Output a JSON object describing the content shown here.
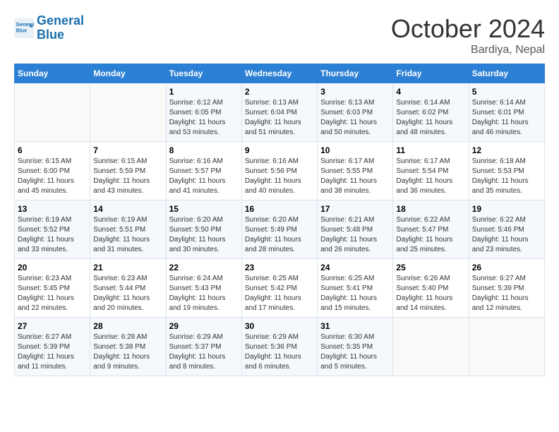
{
  "header": {
    "logo_line1": "General",
    "logo_line2": "Blue",
    "month": "October 2024",
    "location": "Bardiya, Nepal"
  },
  "weekdays": [
    "Sunday",
    "Monday",
    "Tuesday",
    "Wednesday",
    "Thursday",
    "Friday",
    "Saturday"
  ],
  "weeks": [
    [
      {
        "day": "",
        "text": ""
      },
      {
        "day": "",
        "text": ""
      },
      {
        "day": "1",
        "text": "Sunrise: 6:12 AM\nSunset: 6:05 PM\nDaylight: 11 hours and 53 minutes."
      },
      {
        "day": "2",
        "text": "Sunrise: 6:13 AM\nSunset: 6:04 PM\nDaylight: 11 hours and 51 minutes."
      },
      {
        "day": "3",
        "text": "Sunrise: 6:13 AM\nSunset: 6:03 PM\nDaylight: 11 hours and 50 minutes."
      },
      {
        "day": "4",
        "text": "Sunrise: 6:14 AM\nSunset: 6:02 PM\nDaylight: 11 hours and 48 minutes."
      },
      {
        "day": "5",
        "text": "Sunrise: 6:14 AM\nSunset: 6:01 PM\nDaylight: 11 hours and 46 minutes."
      }
    ],
    [
      {
        "day": "6",
        "text": "Sunrise: 6:15 AM\nSunset: 6:00 PM\nDaylight: 11 hours and 45 minutes."
      },
      {
        "day": "7",
        "text": "Sunrise: 6:15 AM\nSunset: 5:59 PM\nDaylight: 11 hours and 43 minutes."
      },
      {
        "day": "8",
        "text": "Sunrise: 6:16 AM\nSunset: 5:57 PM\nDaylight: 11 hours and 41 minutes."
      },
      {
        "day": "9",
        "text": "Sunrise: 6:16 AM\nSunset: 5:56 PM\nDaylight: 11 hours and 40 minutes."
      },
      {
        "day": "10",
        "text": "Sunrise: 6:17 AM\nSunset: 5:55 PM\nDaylight: 11 hours and 38 minutes."
      },
      {
        "day": "11",
        "text": "Sunrise: 6:17 AM\nSunset: 5:54 PM\nDaylight: 11 hours and 36 minutes."
      },
      {
        "day": "12",
        "text": "Sunrise: 6:18 AM\nSunset: 5:53 PM\nDaylight: 11 hours and 35 minutes."
      }
    ],
    [
      {
        "day": "13",
        "text": "Sunrise: 6:19 AM\nSunset: 5:52 PM\nDaylight: 11 hours and 33 minutes."
      },
      {
        "day": "14",
        "text": "Sunrise: 6:19 AM\nSunset: 5:51 PM\nDaylight: 11 hours and 31 minutes."
      },
      {
        "day": "15",
        "text": "Sunrise: 6:20 AM\nSunset: 5:50 PM\nDaylight: 11 hours and 30 minutes."
      },
      {
        "day": "16",
        "text": "Sunrise: 6:20 AM\nSunset: 5:49 PM\nDaylight: 11 hours and 28 minutes."
      },
      {
        "day": "17",
        "text": "Sunrise: 6:21 AM\nSunset: 5:48 PM\nDaylight: 11 hours and 26 minutes."
      },
      {
        "day": "18",
        "text": "Sunrise: 6:22 AM\nSunset: 5:47 PM\nDaylight: 11 hours and 25 minutes."
      },
      {
        "day": "19",
        "text": "Sunrise: 6:22 AM\nSunset: 5:46 PM\nDaylight: 11 hours and 23 minutes."
      }
    ],
    [
      {
        "day": "20",
        "text": "Sunrise: 6:23 AM\nSunset: 5:45 PM\nDaylight: 11 hours and 22 minutes."
      },
      {
        "day": "21",
        "text": "Sunrise: 6:23 AM\nSunset: 5:44 PM\nDaylight: 11 hours and 20 minutes."
      },
      {
        "day": "22",
        "text": "Sunrise: 6:24 AM\nSunset: 5:43 PM\nDaylight: 11 hours and 19 minutes."
      },
      {
        "day": "23",
        "text": "Sunrise: 6:25 AM\nSunset: 5:42 PM\nDaylight: 11 hours and 17 minutes."
      },
      {
        "day": "24",
        "text": "Sunrise: 6:25 AM\nSunset: 5:41 PM\nDaylight: 11 hours and 15 minutes."
      },
      {
        "day": "25",
        "text": "Sunrise: 6:26 AM\nSunset: 5:40 PM\nDaylight: 11 hours and 14 minutes."
      },
      {
        "day": "26",
        "text": "Sunrise: 6:27 AM\nSunset: 5:39 PM\nDaylight: 11 hours and 12 minutes."
      }
    ],
    [
      {
        "day": "27",
        "text": "Sunrise: 6:27 AM\nSunset: 5:39 PM\nDaylight: 11 hours and 11 minutes."
      },
      {
        "day": "28",
        "text": "Sunrise: 6:28 AM\nSunset: 5:38 PM\nDaylight: 11 hours and 9 minutes."
      },
      {
        "day": "29",
        "text": "Sunrise: 6:29 AM\nSunset: 5:37 PM\nDaylight: 11 hours and 8 minutes."
      },
      {
        "day": "30",
        "text": "Sunrise: 6:29 AM\nSunset: 5:36 PM\nDaylight: 11 hours and 6 minutes."
      },
      {
        "day": "31",
        "text": "Sunrise: 6:30 AM\nSunset: 5:35 PM\nDaylight: 11 hours and 5 minutes."
      },
      {
        "day": "",
        "text": ""
      },
      {
        "day": "",
        "text": ""
      }
    ]
  ]
}
